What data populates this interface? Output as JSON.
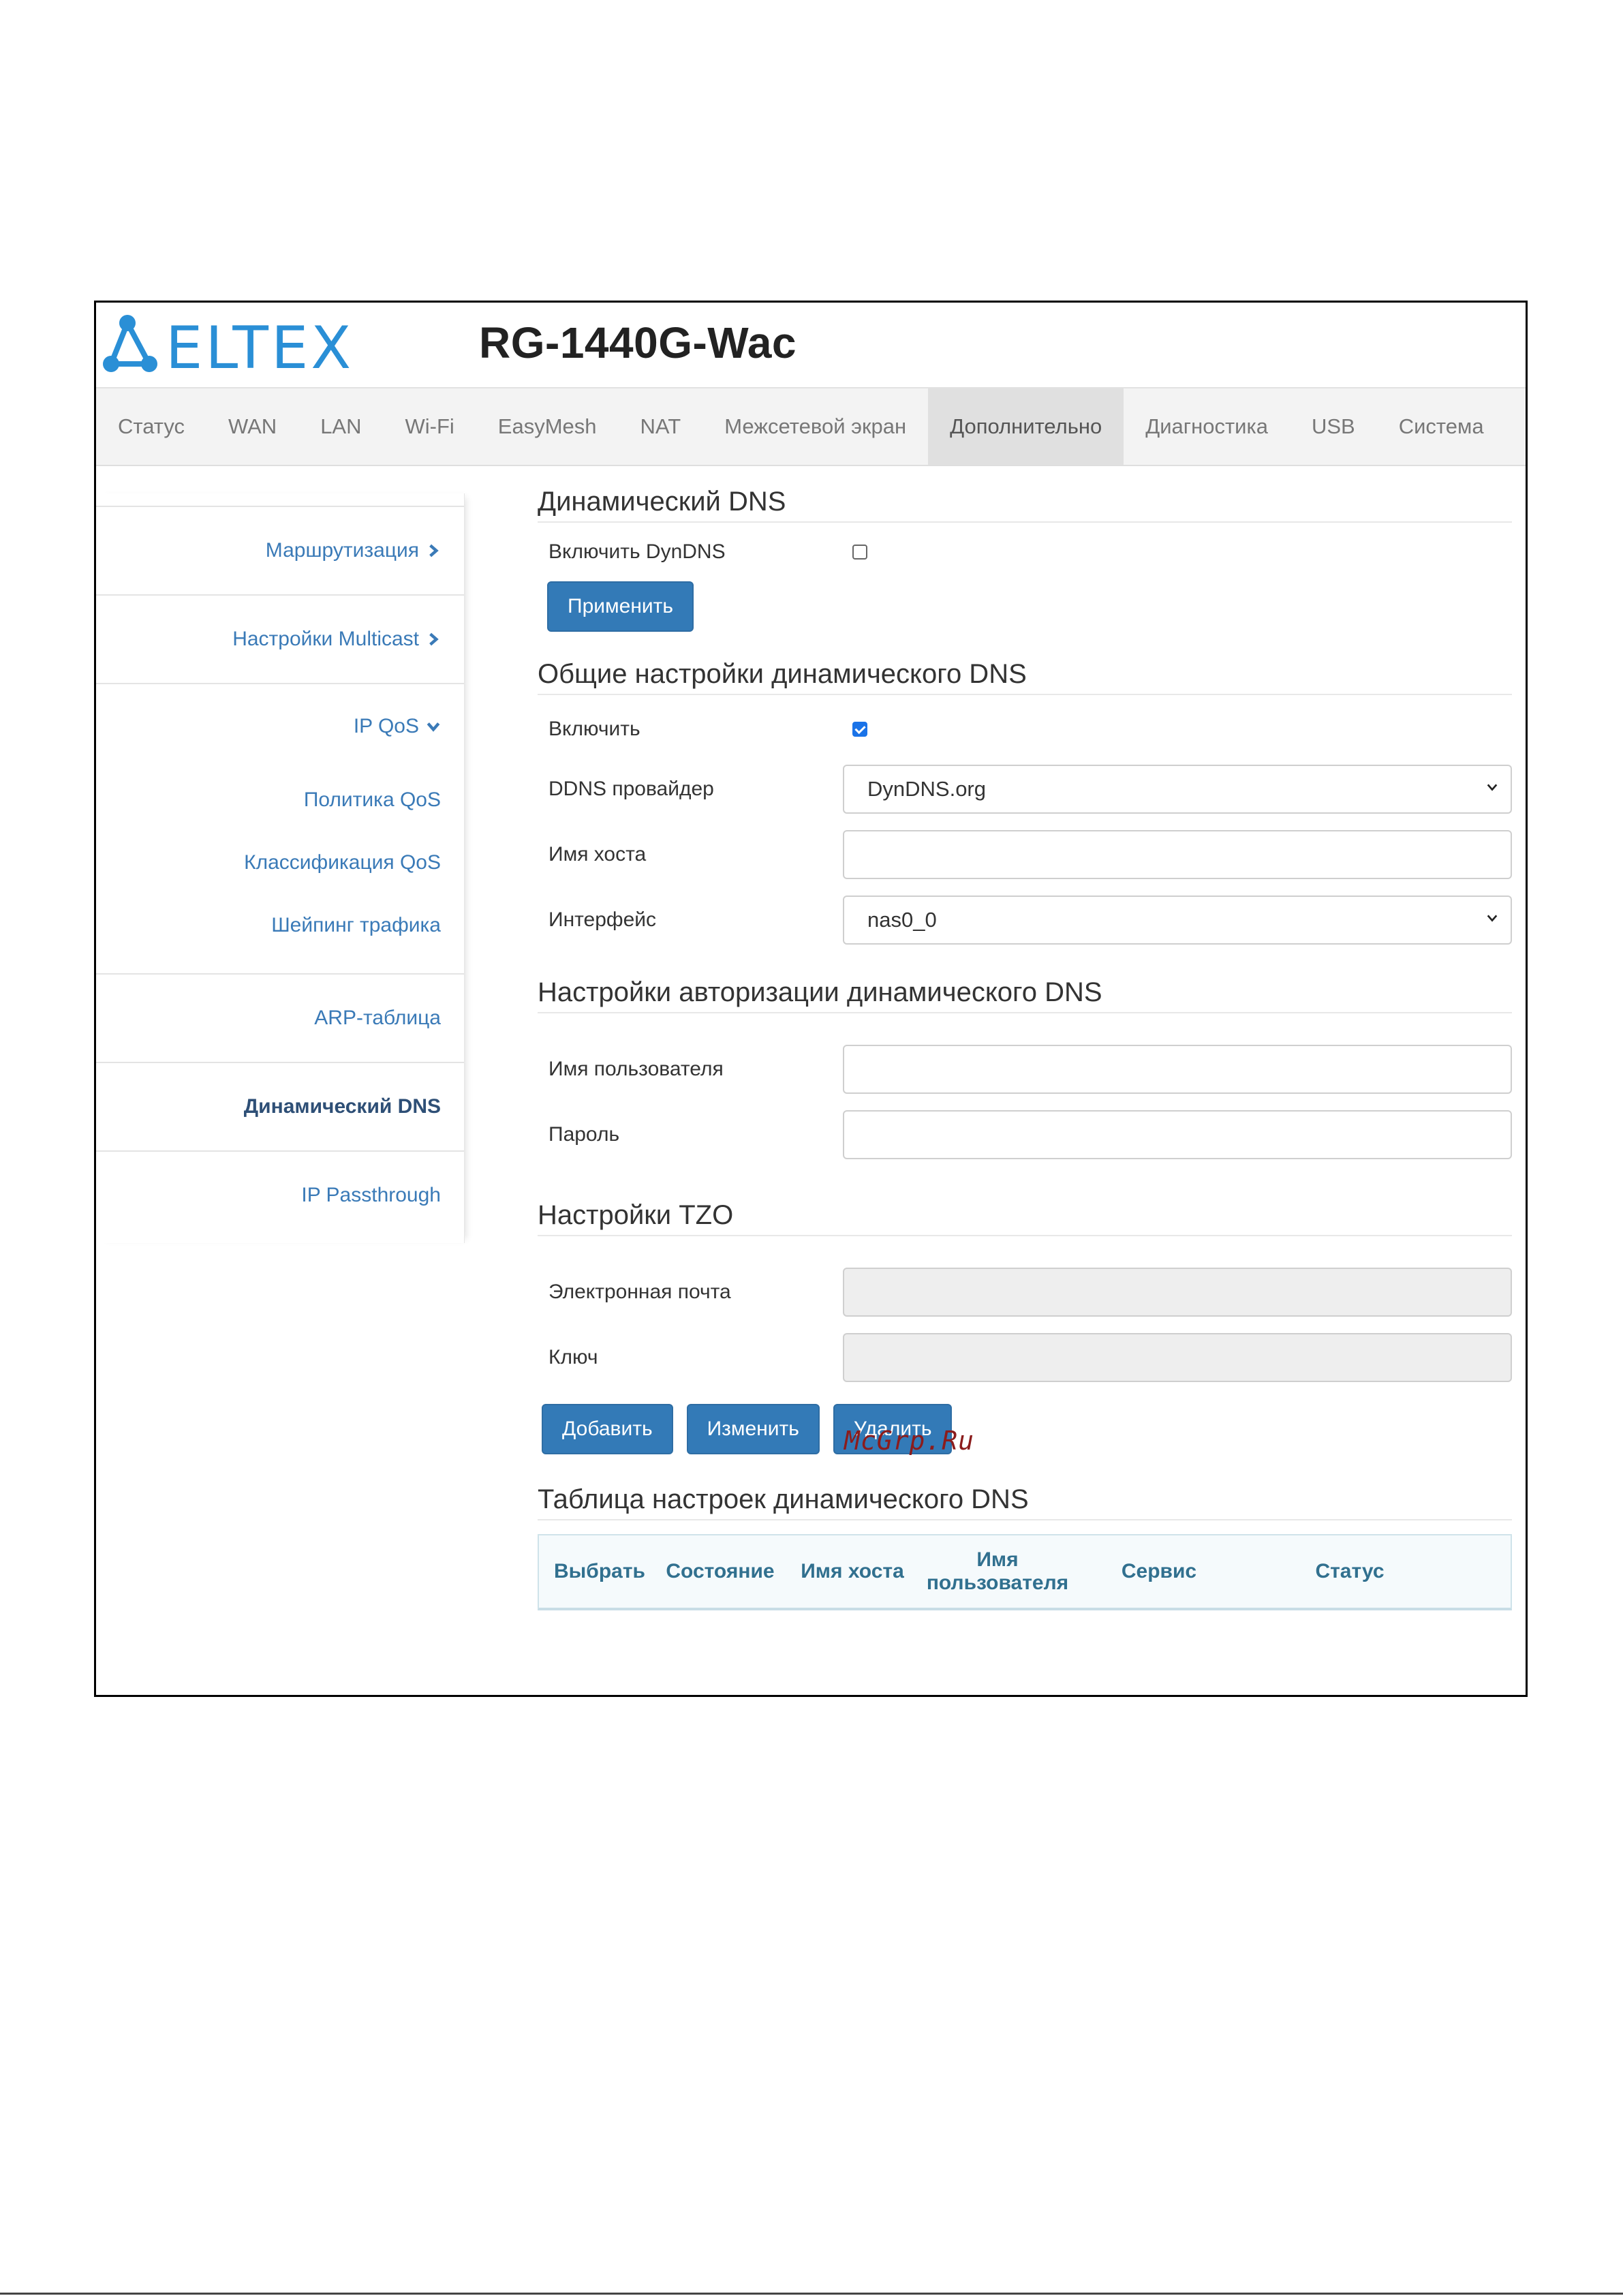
{
  "header": {
    "logo_text": "ELTEX",
    "device_title": "RG-1440G-Wac"
  },
  "nav": {
    "items": [
      {
        "label": "Статус"
      },
      {
        "label": "WAN"
      },
      {
        "label": "LAN"
      },
      {
        "label": "Wi-Fi"
      },
      {
        "label": "EasyMesh"
      },
      {
        "label": "NAT"
      },
      {
        "label": "Межсетевой экран"
      },
      {
        "label": "Дополнительно",
        "active": true
      },
      {
        "label": "Диагностика"
      },
      {
        "label": "USB"
      },
      {
        "label": "Система"
      }
    ]
  },
  "sidebar": {
    "routing": "Маршрутизация",
    "multicast": "Настройки Multicast",
    "ipqos": "IP QoS",
    "qos_policy": "Политика QoS",
    "qos_class": "Классификация QoS",
    "shaping": "Шейпинг трафика",
    "arp": "ARP-таблица",
    "ddns": "Динамический DNS",
    "passthrough": "IP Passthrough"
  },
  "ddns_section": {
    "title": "Динамический DNS",
    "enable_label": "Включить DynDNS",
    "enable_checked": false,
    "apply_button": "Применить"
  },
  "general_section": {
    "title": "Общие настройки динамического DNS",
    "enable_label": "Включить",
    "enable_checked": true,
    "provider_label": "DDNS провайдер",
    "provider_value": "DynDNS.org",
    "hostname_label": "Имя хоста",
    "hostname_value": "",
    "interface_label": "Интерфейс",
    "interface_value": "nas0_0"
  },
  "auth_section": {
    "title": "Настройки авторизации динамического DNS",
    "username_label": "Имя пользователя",
    "username_value": "",
    "password_label": "Пароль",
    "password_value": ""
  },
  "tzo_section": {
    "title": "Настройки TZO",
    "email_label": "Электронная почта",
    "key_label": "Ключ",
    "add_button": "Добавить",
    "edit_button": "Изменить",
    "delete_button": "Удалить"
  },
  "table_section": {
    "title": "Таблица настроек динамического DNS",
    "columns": [
      "Выбрать",
      "Состояние",
      "Имя хоста",
      "Имя пользователя",
      "Сервис",
      "Статус"
    ]
  },
  "watermark": "McGrp.Ru",
  "colors": {
    "accent": "#337ab7",
    "link": "#3a7ab7",
    "table_header": "#31708f",
    "logo": "#2a8fd6"
  }
}
